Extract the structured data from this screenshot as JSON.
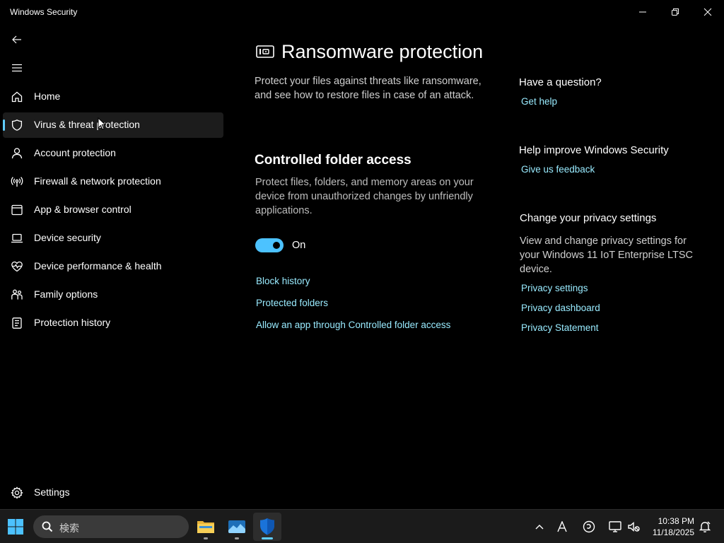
{
  "window": {
    "title": "Windows Security"
  },
  "sidebar": {
    "items": [
      {
        "label": "Home",
        "icon": "home-icon"
      },
      {
        "label": "Virus & threat protection",
        "icon": "shield-icon",
        "active": true
      },
      {
        "label": "Account protection",
        "icon": "person-icon"
      },
      {
        "label": "Firewall & network protection",
        "icon": "antenna-icon"
      },
      {
        "label": "App & browser control",
        "icon": "app-window-icon"
      },
      {
        "label": "Device security",
        "icon": "laptop-icon"
      },
      {
        "label": "Device performance & health",
        "icon": "heart-icon"
      },
      {
        "label": "Family options",
        "icon": "family-icon"
      },
      {
        "label": "Protection history",
        "icon": "history-icon"
      }
    ],
    "settings_label": "Settings"
  },
  "main": {
    "title": "Ransomware protection",
    "intro": "Protect your files against threats like ransomware, and see how to restore files in case of an attack.",
    "cfa": {
      "title": "Controlled folder access",
      "description": "Protect files, folders, and memory areas on your device from unauthorized changes by unfriendly applications.",
      "toggle_state": "On",
      "toggle_on": true
    },
    "links": {
      "block_history": "Block history",
      "protected_folders": "Protected folders",
      "allow_app": "Allow an app through Controlled folder access"
    }
  },
  "right": {
    "question": {
      "heading": "Have a question?",
      "link": "Get help"
    },
    "improve": {
      "heading": "Help improve Windows Security",
      "link": "Give us feedback"
    },
    "privacy": {
      "heading": "Change your privacy settings",
      "text": "View and change privacy settings for your Windows 11 IoT Enterprise LTSC device.",
      "links": [
        "Privacy settings",
        "Privacy dashboard",
        "Privacy Statement"
      ]
    }
  },
  "taskbar": {
    "search_placeholder": "検索",
    "time": "10:38 PM",
    "date": "11/18/2025"
  },
  "colors": {
    "accent": "#60cdff",
    "link": "#99ebff",
    "toggle": "#4cc2ff",
    "background": "#000000"
  }
}
